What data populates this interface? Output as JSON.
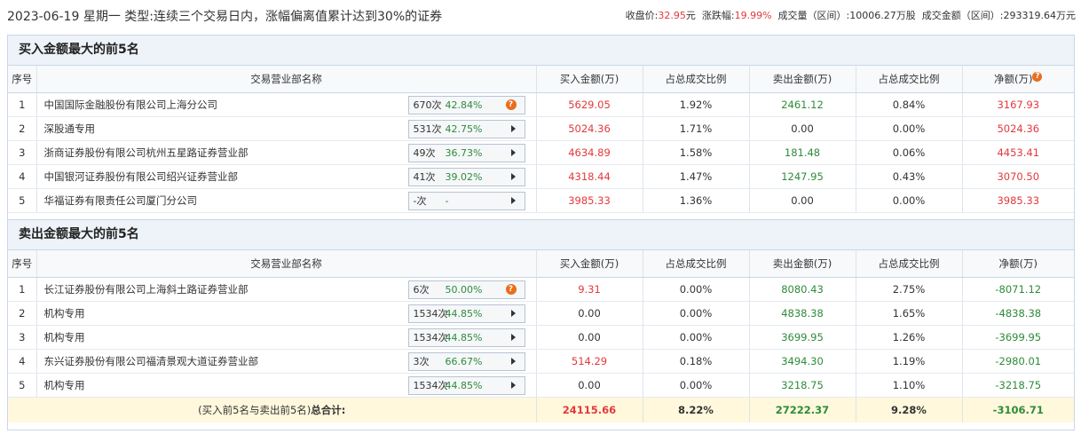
{
  "header": {
    "date": "2023-06-19",
    "weekday": "星期一",
    "type_prefix": "类型:",
    "type_text": "连续三个交易日内，涨幅偏离值累计达到30%的证券",
    "close_label": "收盘价:",
    "close_value": "32.95",
    "close_unit": "元",
    "change_label": "涨跌幅:",
    "change_value": "19.99%",
    "volume_label": "成交量（区间）:",
    "volume_value": "10006.27万股",
    "amount_label": "成交金额（区间）:",
    "amount_value": "293319.64万元"
  },
  "columns": {
    "seq": "序号",
    "name": "交易营业部名称",
    "buy": "买入金额(万)",
    "buy_ratio": "占总成交比例",
    "sell": "卖出金额(万)",
    "sell_ratio": "占总成交比例",
    "net": "净额(万)"
  },
  "buy_section": {
    "title": "买入金额最大的前5名",
    "rows": [
      {
        "seq": "1",
        "name": "中国国际金融股份有限公司上海分公司",
        "count": "670次",
        "pct": "42.84%",
        "icon": "question",
        "buy": "5629.05",
        "buy_ratio": "1.92%",
        "sell": "2461.12",
        "sell_ratio": "0.84%",
        "net": "3167.93"
      },
      {
        "seq": "2",
        "name": "深股通专用",
        "count": "531次",
        "pct": "42.75%",
        "icon": "arrow",
        "buy": "5024.36",
        "buy_ratio": "1.71%",
        "sell": "0.00",
        "sell_ratio": "0.00%",
        "net": "5024.36"
      },
      {
        "seq": "3",
        "name": "浙商证券股份有限公司杭州五星路证券营业部",
        "count": "49次",
        "pct": "36.73%",
        "icon": "arrow",
        "buy": "4634.89",
        "buy_ratio": "1.58%",
        "sell": "181.48",
        "sell_ratio": "0.06%",
        "net": "4453.41"
      },
      {
        "seq": "4",
        "name": "中国银河证券股份有限公司绍兴证券营业部",
        "count": "41次",
        "pct": "39.02%",
        "icon": "arrow",
        "buy": "4318.44",
        "buy_ratio": "1.47%",
        "sell": "1247.95",
        "sell_ratio": "0.43%",
        "net": "3070.50"
      },
      {
        "seq": "5",
        "name": "华福证券有限责任公司厦门分公司",
        "count": "-次",
        "pct": "-",
        "icon": "arrow",
        "buy": "3985.33",
        "buy_ratio": "1.36%",
        "sell": "0.00",
        "sell_ratio": "0.00%",
        "net": "3985.33"
      }
    ]
  },
  "sell_section": {
    "title": "卖出金额最大的前5名",
    "rows": [
      {
        "seq": "1",
        "name": "长江证券股份有限公司上海斜土路证券营业部",
        "count": "6次",
        "pct": "50.00%",
        "icon": "question",
        "buy": "9.31",
        "buy_ratio": "0.00%",
        "sell": "8080.43",
        "sell_ratio": "2.75%",
        "net": "-8071.12"
      },
      {
        "seq": "2",
        "name": "机构专用",
        "count": "1534次",
        "pct": "44.85%",
        "icon": "arrow",
        "buy": "0.00",
        "buy_ratio": "0.00%",
        "sell": "4838.38",
        "sell_ratio": "1.65%",
        "net": "-4838.38"
      },
      {
        "seq": "3",
        "name": "机构专用",
        "count": "1534次",
        "pct": "44.85%",
        "icon": "arrow",
        "buy": "0.00",
        "buy_ratio": "0.00%",
        "sell": "3699.95",
        "sell_ratio": "1.26%",
        "net": "-3699.95"
      },
      {
        "seq": "4",
        "name": "东兴证券股份有限公司福清景观大道证券营业部",
        "count": "3次",
        "pct": "66.67%",
        "icon": "arrow",
        "buy": "514.29",
        "buy_ratio": "0.18%",
        "sell": "3494.30",
        "sell_ratio": "1.19%",
        "net": "-2980.01"
      },
      {
        "seq": "5",
        "name": "机构专用",
        "count": "1534次",
        "pct": "44.85%",
        "icon": "arrow",
        "buy": "0.00",
        "buy_ratio": "0.00%",
        "sell": "3218.75",
        "sell_ratio": "1.10%",
        "net": "-3218.75"
      }
    ],
    "total": {
      "label": "(买入前5名与卖出前5名)",
      "label_bold": "总合计:",
      "buy": "24115.66",
      "buy_ratio": "8.22%",
      "sell": "27222.37",
      "sell_ratio": "9.28%",
      "net": "-3106.71"
    }
  },
  "colors": {
    "positive": "#e4393c",
    "negative": "#2e8b3a",
    "header_bg": "#eef3f9",
    "total_bg": "#fff8dd",
    "icon_orange": "#e96e1c"
  }
}
